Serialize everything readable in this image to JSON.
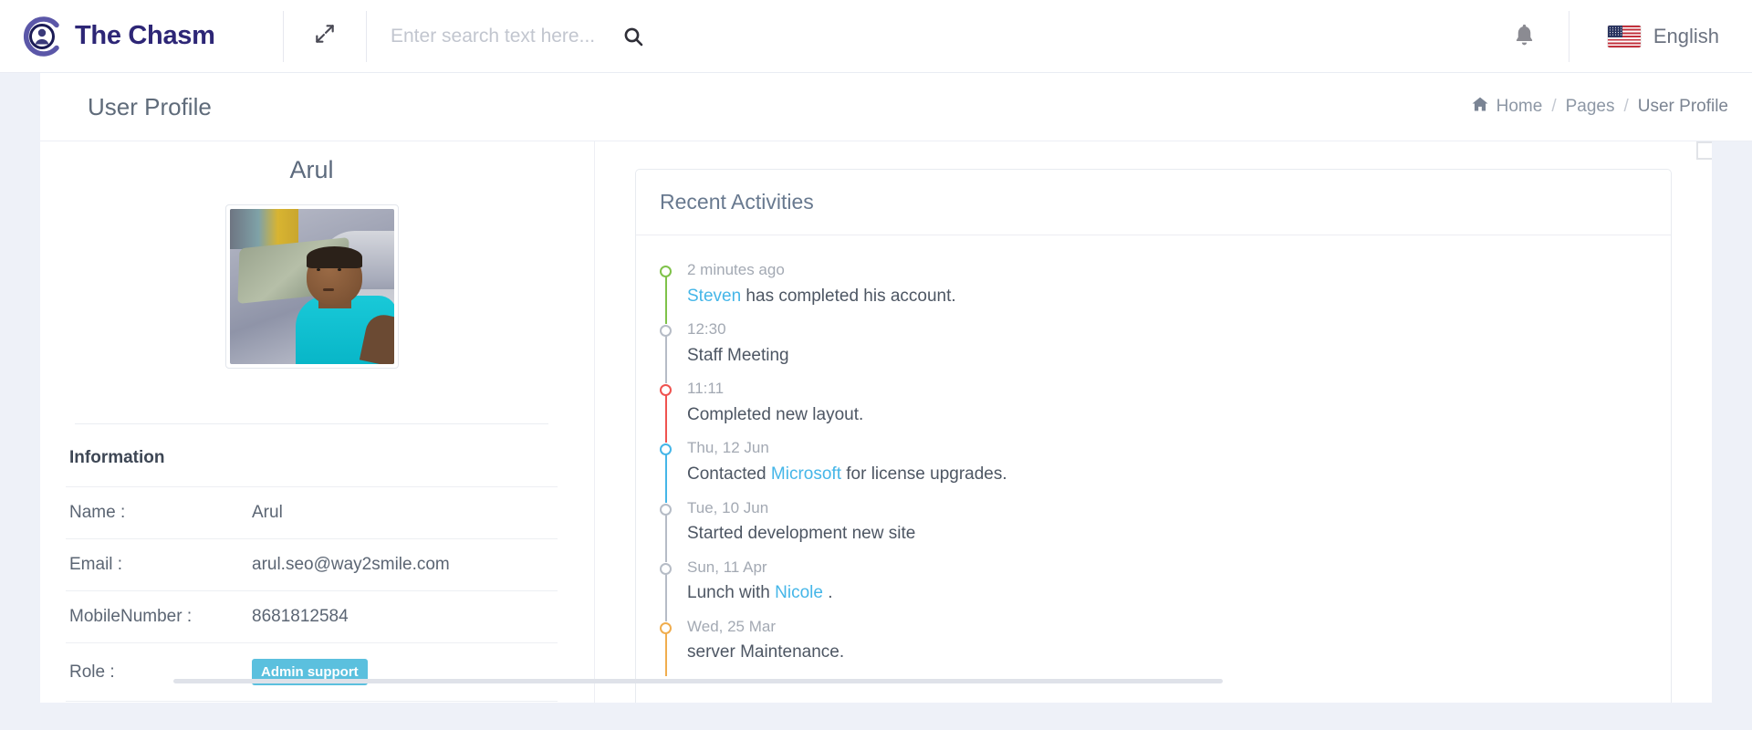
{
  "topbar": {
    "brand_name": "The Chasm",
    "logo_icon": "user-circle-logo",
    "expand_icon": "fullscreen-expand-icon",
    "search": {
      "placeholder": "Enter search text here...",
      "value": "",
      "icon": "search-icon"
    },
    "notifications_icon": "bell-icon",
    "language": {
      "label": "English",
      "flag_icon": "us-flag-icon"
    }
  },
  "pagehead": {
    "title": "User Profile",
    "breadcrumb": {
      "home_icon": "home-icon",
      "home": "Home",
      "sep1": "/",
      "pages": "Pages",
      "sep2": "/",
      "current": "User Profile"
    }
  },
  "profile": {
    "display_name": "Arul",
    "avatar_alt": "profile-photo",
    "info_heading": "Information",
    "rows": [
      {
        "key": "Name :",
        "value": "Arul",
        "type": "text"
      },
      {
        "key": "Email :",
        "value": "arul.seo@way2smile.com",
        "type": "text"
      },
      {
        "key": "MobileNumber :",
        "value": "8681812584",
        "type": "text"
      },
      {
        "key": "Role :",
        "value": "Admin support",
        "type": "badge"
      }
    ]
  },
  "activities": {
    "title": "Recent Activities",
    "items": [
      {
        "time": "2 minutes ago",
        "text_before": "",
        "highlight": "Steven",
        "text_after": " has completed his account.",
        "color": "#7fc24a"
      },
      {
        "time": "12:30",
        "text_before": "Staff Meeting",
        "highlight": "",
        "text_after": "",
        "color": "#b6bcc6"
      },
      {
        "time": "11:11",
        "text_before": "Completed new layout.",
        "highlight": "",
        "text_after": "",
        "color": "#ef5350"
      },
      {
        "time": "Thu, 12 Jun",
        "text_before": "Contacted ",
        "highlight": "Microsoft",
        "text_after": " for license upgrades.",
        "color": "#45b6e8"
      },
      {
        "time": "Tue, 10 Jun",
        "text_before": "Started development new site",
        "highlight": "",
        "text_after": "",
        "color": "#b6bcc6"
      },
      {
        "time": "Sun, 11 Apr",
        "text_before": "Lunch with ",
        "highlight": "Nicole",
        "text_after": " .",
        "color": "#b6bcc6"
      },
      {
        "time": "Wed, 25 Mar",
        "text_before": "server Maintenance.",
        "highlight": "",
        "text_after": "",
        "color": "#f0ad4e"
      }
    ]
  },
  "colors": {
    "brand": "#2d2676",
    "badge_bg": "#5bc0de",
    "link": "#45b6e8",
    "page_bg": "#eef1f8"
  }
}
